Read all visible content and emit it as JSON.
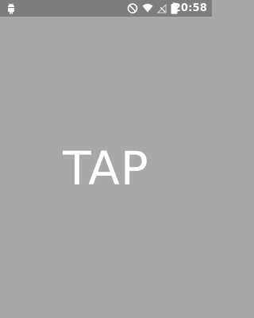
{
  "status_bar": {
    "time": "20:58",
    "icons": [
      "android-notification-icon",
      "do-not-disturb-icon",
      "wifi-icon",
      "cell-signal-icon",
      "battery-icon"
    ]
  },
  "main": {
    "tap_label": "TAP"
  },
  "colors": {
    "status_bar_bg": "#7d7d7d",
    "screen_bg": "#a8a8a8",
    "text": "#ffffff"
  }
}
